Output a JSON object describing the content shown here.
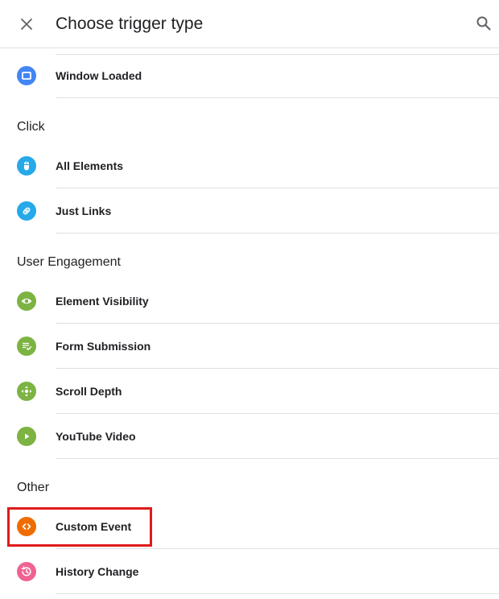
{
  "header": {
    "title": "Choose trigger type"
  },
  "items": {
    "window_loaded": {
      "label": "Window Loaded",
      "color": "#4285f4",
      "icon": "window-icon"
    },
    "all_elements": {
      "label": "All Elements",
      "color": "#26a9e8",
      "icon": "mouse-icon"
    },
    "just_links": {
      "label": "Just Links",
      "color": "#26a9e8",
      "icon": "link-icon"
    },
    "element_visibility": {
      "label": "Element Visibility",
      "color": "#7cb342",
      "icon": "eye-icon"
    },
    "form_submission": {
      "label": "Form Submission",
      "color": "#7cb342",
      "icon": "form-check-icon"
    },
    "scroll_depth": {
      "label": "Scroll Depth",
      "color": "#7cb342",
      "icon": "move-arrows-icon"
    },
    "youtube_video": {
      "label": "YouTube Video",
      "color": "#7cb342",
      "icon": "play-icon"
    },
    "custom_event": {
      "label": "Custom Event",
      "color": "#ef6c00",
      "icon": "code-icon"
    },
    "history_change": {
      "label": "History Change",
      "color": "#f06292",
      "icon": "history-icon"
    }
  },
  "sections": {
    "click": "Click",
    "user_engagement": "User Engagement",
    "other": "Other"
  },
  "highlight_color": "#e01b1b"
}
